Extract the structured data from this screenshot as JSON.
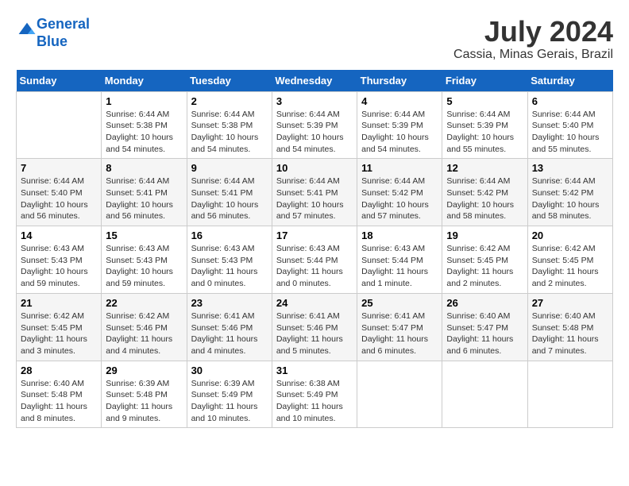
{
  "header": {
    "logo_line1": "General",
    "logo_line2": "Blue",
    "month_year": "July 2024",
    "location": "Cassia, Minas Gerais, Brazil"
  },
  "days_of_week": [
    "Sunday",
    "Monday",
    "Tuesday",
    "Wednesday",
    "Thursday",
    "Friday",
    "Saturday"
  ],
  "weeks": [
    [
      {
        "day": "",
        "info": ""
      },
      {
        "day": "1",
        "info": "Sunrise: 6:44 AM\nSunset: 5:38 PM\nDaylight: 10 hours\nand 54 minutes."
      },
      {
        "day": "2",
        "info": "Sunrise: 6:44 AM\nSunset: 5:38 PM\nDaylight: 10 hours\nand 54 minutes."
      },
      {
        "day": "3",
        "info": "Sunrise: 6:44 AM\nSunset: 5:39 PM\nDaylight: 10 hours\nand 54 minutes."
      },
      {
        "day": "4",
        "info": "Sunrise: 6:44 AM\nSunset: 5:39 PM\nDaylight: 10 hours\nand 54 minutes."
      },
      {
        "day": "5",
        "info": "Sunrise: 6:44 AM\nSunset: 5:39 PM\nDaylight: 10 hours\nand 55 minutes."
      },
      {
        "day": "6",
        "info": "Sunrise: 6:44 AM\nSunset: 5:40 PM\nDaylight: 10 hours\nand 55 minutes."
      }
    ],
    [
      {
        "day": "7",
        "info": "Sunrise: 6:44 AM\nSunset: 5:40 PM\nDaylight: 10 hours\nand 56 minutes."
      },
      {
        "day": "8",
        "info": "Sunrise: 6:44 AM\nSunset: 5:41 PM\nDaylight: 10 hours\nand 56 minutes."
      },
      {
        "day": "9",
        "info": "Sunrise: 6:44 AM\nSunset: 5:41 PM\nDaylight: 10 hours\nand 56 minutes."
      },
      {
        "day": "10",
        "info": "Sunrise: 6:44 AM\nSunset: 5:41 PM\nDaylight: 10 hours\nand 57 minutes."
      },
      {
        "day": "11",
        "info": "Sunrise: 6:44 AM\nSunset: 5:42 PM\nDaylight: 10 hours\nand 57 minutes."
      },
      {
        "day": "12",
        "info": "Sunrise: 6:44 AM\nSunset: 5:42 PM\nDaylight: 10 hours\nand 58 minutes."
      },
      {
        "day": "13",
        "info": "Sunrise: 6:44 AM\nSunset: 5:42 PM\nDaylight: 10 hours\nand 58 minutes."
      }
    ],
    [
      {
        "day": "14",
        "info": "Sunrise: 6:43 AM\nSunset: 5:43 PM\nDaylight: 10 hours\nand 59 minutes."
      },
      {
        "day": "15",
        "info": "Sunrise: 6:43 AM\nSunset: 5:43 PM\nDaylight: 10 hours\nand 59 minutes."
      },
      {
        "day": "16",
        "info": "Sunrise: 6:43 AM\nSunset: 5:43 PM\nDaylight: 11 hours\nand 0 minutes."
      },
      {
        "day": "17",
        "info": "Sunrise: 6:43 AM\nSunset: 5:44 PM\nDaylight: 11 hours\nand 0 minutes."
      },
      {
        "day": "18",
        "info": "Sunrise: 6:43 AM\nSunset: 5:44 PM\nDaylight: 11 hours\nand 1 minute."
      },
      {
        "day": "19",
        "info": "Sunrise: 6:42 AM\nSunset: 5:45 PM\nDaylight: 11 hours\nand 2 minutes."
      },
      {
        "day": "20",
        "info": "Sunrise: 6:42 AM\nSunset: 5:45 PM\nDaylight: 11 hours\nand 2 minutes."
      }
    ],
    [
      {
        "day": "21",
        "info": "Sunrise: 6:42 AM\nSunset: 5:45 PM\nDaylight: 11 hours\nand 3 minutes."
      },
      {
        "day": "22",
        "info": "Sunrise: 6:42 AM\nSunset: 5:46 PM\nDaylight: 11 hours\nand 4 minutes."
      },
      {
        "day": "23",
        "info": "Sunrise: 6:41 AM\nSunset: 5:46 PM\nDaylight: 11 hours\nand 4 minutes."
      },
      {
        "day": "24",
        "info": "Sunrise: 6:41 AM\nSunset: 5:46 PM\nDaylight: 11 hours\nand 5 minutes."
      },
      {
        "day": "25",
        "info": "Sunrise: 6:41 AM\nSunset: 5:47 PM\nDaylight: 11 hours\nand 6 minutes."
      },
      {
        "day": "26",
        "info": "Sunrise: 6:40 AM\nSunset: 5:47 PM\nDaylight: 11 hours\nand 6 minutes."
      },
      {
        "day": "27",
        "info": "Sunrise: 6:40 AM\nSunset: 5:48 PM\nDaylight: 11 hours\nand 7 minutes."
      }
    ],
    [
      {
        "day": "28",
        "info": "Sunrise: 6:40 AM\nSunset: 5:48 PM\nDaylight: 11 hours\nand 8 minutes."
      },
      {
        "day": "29",
        "info": "Sunrise: 6:39 AM\nSunset: 5:48 PM\nDaylight: 11 hours\nand 9 minutes."
      },
      {
        "day": "30",
        "info": "Sunrise: 6:39 AM\nSunset: 5:49 PM\nDaylight: 11 hours\nand 10 minutes."
      },
      {
        "day": "31",
        "info": "Sunrise: 6:38 AM\nSunset: 5:49 PM\nDaylight: 11 hours\nand 10 minutes."
      },
      {
        "day": "",
        "info": ""
      },
      {
        "day": "",
        "info": ""
      },
      {
        "day": "",
        "info": ""
      }
    ]
  ]
}
